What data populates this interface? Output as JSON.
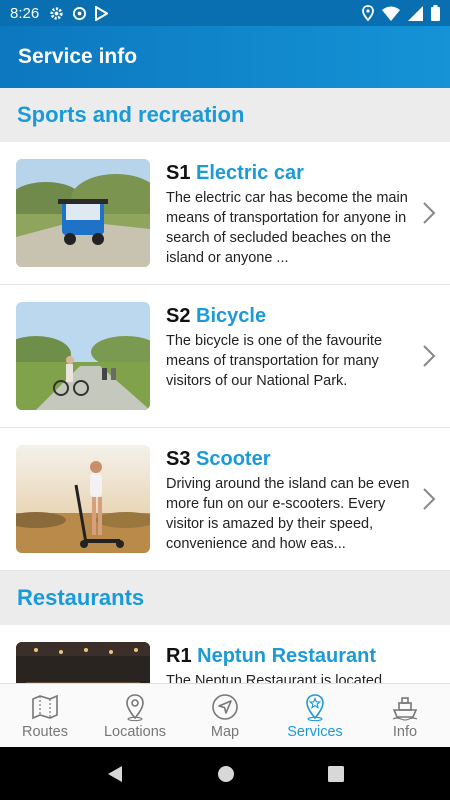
{
  "status_bar": {
    "time": "8:26",
    "icons": [
      "gear-icon",
      "at-icon",
      "play-store-icon",
      "location-icon",
      "wifi-icon",
      "signal-icon",
      "battery-icon"
    ]
  },
  "app_bar": {
    "title": "Service info"
  },
  "sections": [
    {
      "title": "Sports and recreation",
      "items": [
        {
          "code": "S1",
          "name": "Electric car",
          "description": "The electric car has become the main means of transportation for anyone in search of secluded beaches on the island or anyone ...",
          "image": "electric-car-photo"
        },
        {
          "code": "S2",
          "name": "Bicycle",
          "description": "The bicycle is one of the favourite means of transportation for many visitors of our National Park.",
          "image": "bicycle-photo"
        },
        {
          "code": "S3",
          "name": "Scooter",
          "description": "Driving around the island can be even more fun on our e-scooters. Every visitor is amazed by their speed, convenience and how eas...",
          "image": "scooter-photo"
        }
      ]
    },
    {
      "title": "Restaurants",
      "items": [
        {
          "code": "R1",
          "name": "Neptun Restaurant",
          "description": "The Neptun Restaurant is located",
          "image": "restaurant-photo"
        }
      ]
    }
  ],
  "bottom_nav": {
    "items": [
      {
        "label": "Routes",
        "icon": "map-fold-icon"
      },
      {
        "label": "Locations",
        "icon": "location-pin-icon"
      },
      {
        "label": "Map",
        "icon": "compass-arrow-icon"
      },
      {
        "label": "Services",
        "icon": "services-pin-icon"
      },
      {
        "label": "Info",
        "icon": "ship-icon"
      }
    ],
    "active": "Services"
  },
  "colors": {
    "brand_blue": "#0c77bf",
    "accent_blue": "#1a9ad9",
    "section_bg": "#ececec",
    "nav_inactive": "#777777"
  },
  "system_nav": {
    "icons": [
      "back-icon",
      "home-icon",
      "recents-icon"
    ]
  }
}
